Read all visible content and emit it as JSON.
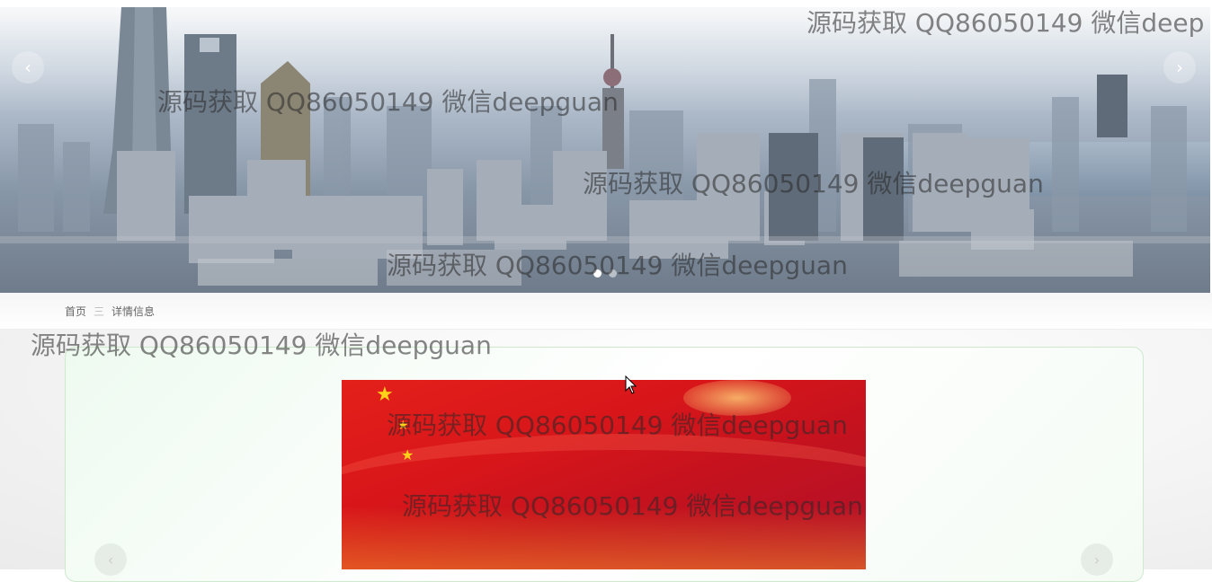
{
  "breadcrumb": {
    "home": "首页",
    "separator": "三",
    "current": "详情信息"
  },
  "banner": {
    "prev_icon": "chevron-left-icon",
    "next_icon": "chevron-right-icon",
    "prev_glyph": "‹",
    "next_glyph": "›",
    "slide_count": 2,
    "active_slide": 1
  },
  "gallery": {
    "prev_glyph": "‹",
    "next_glyph": "›"
  },
  "watermark": {
    "text": "源码获取 QQ86050149 微信deepguan",
    "text_truncated": "源码获取 QQ86050149 微信deep"
  },
  "colors": {
    "card_border": "#cfe9cf",
    "card_bg": "#eefaf0",
    "flag_red": "#d8161a",
    "star_yellow": "#ffd21a"
  }
}
